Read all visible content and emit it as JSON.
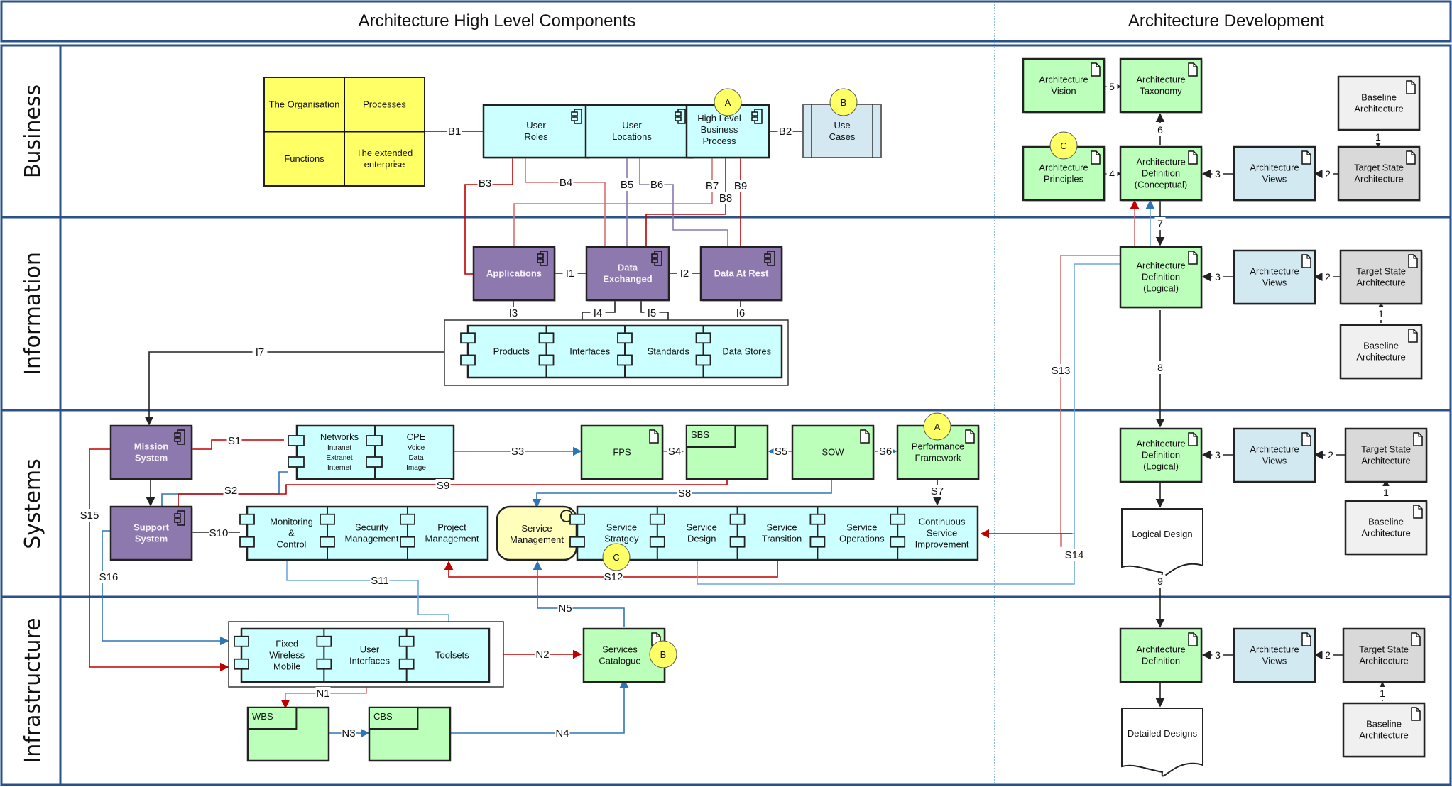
{
  "headers": {
    "left": "Architecture High Level Components",
    "right": "Architecture Development"
  },
  "lanes": [
    "Business",
    "Information",
    "Systems",
    "Infrastructure"
  ],
  "colors": {
    "lane_border": "#2a5288",
    "component": "#ccffff",
    "purple": "#8e79ae",
    "doc_green": "#bbffbb",
    "yellow": "#ffff66",
    "use_case": "#d3e8f0",
    "views": "#d3e9f2",
    "target": "#d9d9d9",
    "baseline": "#f0f0f0",
    "service_mgmt": "#ffffbb",
    "edge_red": "#c00000",
    "edge_blue": "#2e75b6",
    "edge_purple": "#8878b0",
    "edge_black": "#222222"
  },
  "business_matrix": [
    "The Organisation",
    "Processes",
    "Functions",
    "The extended enterprise"
  ],
  "nodes": {
    "user_roles": "User\nRoles",
    "user_locations": "User\nLocations",
    "hlbp": "High Level\nBusiness\nProcess",
    "use_cases": "Use\nCases",
    "applications": "Applications",
    "data_exchanged": "Data\nExchanged",
    "data_at_rest": "Data At Rest",
    "products": "Products",
    "interfaces": "Interfaces",
    "standards": "Standards",
    "data_stores": "Data Stores",
    "mission_system": "Mission\nSystem",
    "support_system": "Support\nSystem",
    "networks": "Networks",
    "networks_sub": "Intranet\nExtranet\nInternet",
    "cpe": "CPE",
    "cpe_sub": "Voice\nData\nImage",
    "fps": "FPS",
    "sbs": "SBS",
    "sow": "SOW",
    "performance_framework": "Performance\nFramework",
    "monitoring": "Monitoring\n&\nControl",
    "security_mgmt": "Security\nManagement",
    "project_mgmt": "Project\nManagement",
    "service_mgmt": "Service\nManagement",
    "service_strategy": "Service\nStratgey",
    "service_design": "Service\nDesign",
    "service_transition": "Service\nTransition",
    "service_operations": "Service\nOperations",
    "csi": "Continuous\nService\nImprovement",
    "fixed_wireless": "Fixed\nWireless\nMobile",
    "user_interfaces": "User\nInterfaces",
    "toolsets": "Toolsets",
    "services_catalogue": "Services\nCatalogue",
    "wbs": "WBS",
    "cbs": "CBS",
    "arch_vision": "Architecture\nVision",
    "arch_taxonomy": "Architecture\nTaxonomy",
    "arch_principles": "Architecture\nPrinciples",
    "arch_def_conceptual": "Architecture\nDefinition\n(Conceptual)",
    "arch_views_1": "Architecture\nViews",
    "target_1": "Target State\nArchitecture",
    "baseline_1": "Baseline\nArchitecture",
    "arch_def_logical_1": "Architecture\nDefinition\n(Logical)",
    "arch_views_2": "Architecture\nViews",
    "target_2": "Target State\nArchitecture",
    "baseline_2": "Baseline\nArchitecture",
    "arch_def_logical_2": "Architecture\nDefinition\n(Logical)",
    "arch_views_3": "Architecture\nViews",
    "target_3": "Target State\nArchitecture",
    "baseline_3": "Baseline\nArchitecture",
    "logical_design": "Logical Design",
    "arch_def": "Architecture\nDefinition",
    "arch_views_4": "Architecture\nViews",
    "target_4": "Target State\nArchitecture",
    "baseline_4": "Baseline\nArchitecture",
    "detailed_designs": "Detailed Designs"
  },
  "badges": {
    "hlbp": "A",
    "use_cases": "B",
    "arch_principles": "C",
    "performance_framework": "A",
    "service_strategy": "C",
    "services_catalogue": "B"
  },
  "edges": {
    "B1": "B1",
    "B2": "B2",
    "B3": "B3",
    "B4": "B4",
    "B5": "B5",
    "B6": "B6",
    "B7": "B7",
    "B8": "B8",
    "B9": "B9",
    "I1": "I1",
    "I2": "I2",
    "I3": "I3",
    "I4": "I4",
    "I5": "I5",
    "I6": "I6",
    "I7": "I7",
    "S1": "S1",
    "S2": "S2",
    "S3": "S3",
    "S4": "S4",
    "S5": "S5",
    "S6": "S6",
    "S7": "S7",
    "S8": "S8",
    "S9": "S9",
    "S10": "S10",
    "S11": "S11",
    "S12": "S12",
    "S13": "S13",
    "S14": "S14",
    "S15": "S15",
    "S16": "S16",
    "N1": "N1",
    "N2": "N2",
    "N3": "N3",
    "N4": "N4",
    "N5": "N5",
    "d1a": "1",
    "d2a": "2",
    "d3a": "3",
    "d4": "4",
    "d5": "5",
    "d6": "6",
    "d7": "7",
    "d1b": "1",
    "d2b": "2",
    "d3b": "3",
    "d8": "8",
    "d1c": "1",
    "d2c": "2",
    "d3c": "3",
    "d9": "9",
    "d1d": "1",
    "d2d": "2",
    "d3d": "3"
  }
}
